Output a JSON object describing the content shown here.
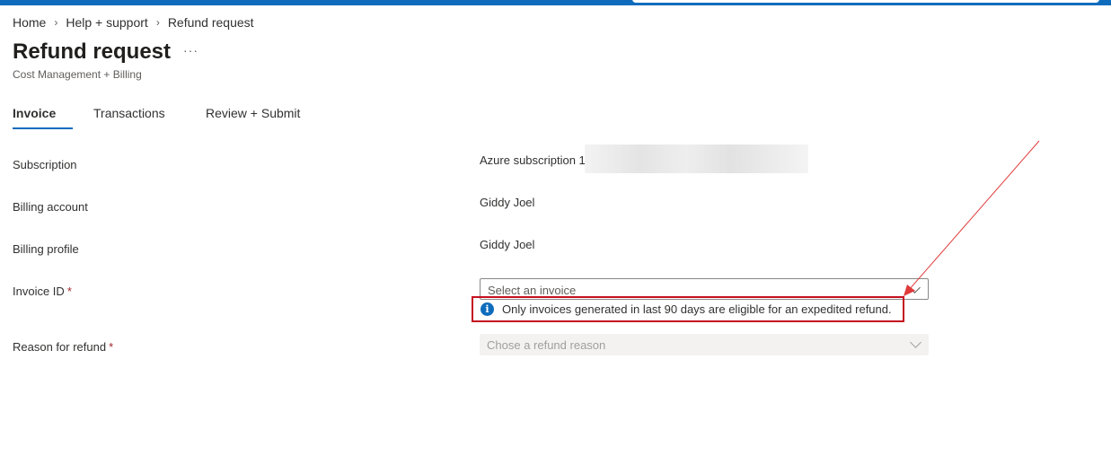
{
  "breadcrumb": {
    "items": [
      "Home",
      "Help + support",
      "Refund request"
    ],
    "separator": "›"
  },
  "page": {
    "title": "Refund request",
    "more": "···",
    "subtitle": "Cost Management + Billing"
  },
  "tabs": [
    {
      "label": "Invoice",
      "active": true
    },
    {
      "label": "Transactions",
      "active": false
    },
    {
      "label": "Review + Submit",
      "active": false
    }
  ],
  "form": {
    "subscription_label": "Subscription",
    "subscription_value": "Azure subscription 1",
    "billing_account_label": "Billing account",
    "billing_account_value": "Giddy Joel",
    "billing_profile_label": "Billing profile",
    "billing_profile_value": "Giddy Joel",
    "invoice_id_label": "Invoice ID",
    "invoice_placeholder": "Select an invoice",
    "info_icon_glyph": "i",
    "info_message": "Only invoices generated in last 90 days are eligible for an expedited refund.",
    "reason_label": "Reason for refund",
    "reason_placeholder": "Chose a refund reason",
    "required_marker": "*"
  },
  "colors": {
    "accent": "#0f6cbd",
    "annotation": "#c50f1f",
    "required": "#a4262c"
  }
}
